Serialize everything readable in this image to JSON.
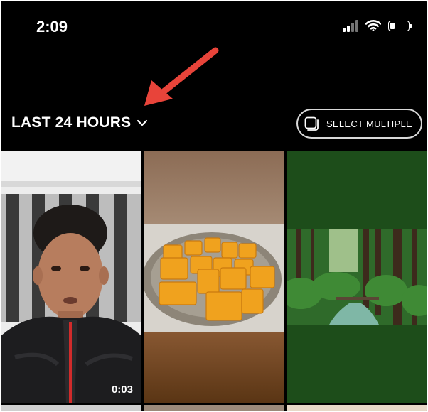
{
  "status_bar": {
    "time": "2:09",
    "signal_icon": "cellular-signal-icon",
    "wifi_icon": "wifi-icon",
    "battery_icon": "battery-icon",
    "battery_level": 0.25
  },
  "header": {
    "album_label": "LAST 24 HOURS",
    "album_chevron_icon": "chevron-down-icon",
    "select_multiple_label": "SELECT MULTIPLE",
    "select_multiple_icon": "multi-select-stack-icon"
  },
  "annotation": {
    "arrow_color": "#e8443a"
  },
  "grid": {
    "items": [
      {
        "type": "video",
        "duration": "0:03"
      },
      {
        "type": "photo"
      },
      {
        "type": "photo"
      }
    ]
  },
  "colors": {
    "background": "#000000",
    "text": "#ffffff",
    "button_border": "#d9d9d9"
  }
}
